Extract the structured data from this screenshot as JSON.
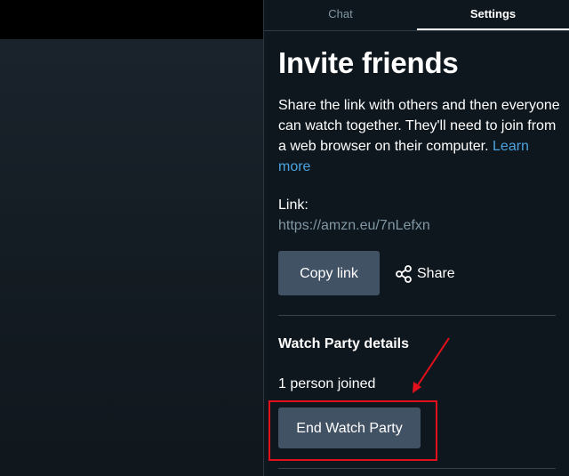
{
  "tabs": [
    {
      "label": "Chat",
      "active": false
    },
    {
      "label": "Settings",
      "active": true
    }
  ],
  "invite": {
    "title": "Invite friends",
    "description": "Share the link with others and then everyone can watch together. They'll need to join from a web browser on their computer.",
    "learn_more": "Learn more",
    "link_label": "Link:",
    "link_value": "https://amzn.eu/7nLefxn",
    "copy_button": "Copy link",
    "share_label": "Share",
    "share_icon": "share-icon"
  },
  "details": {
    "heading": "Watch Party details",
    "joined_text": "1 person joined",
    "end_button": "End Watch Party"
  },
  "colors": {
    "panel_bg": "#0f171e",
    "button_bg": "#425265",
    "link_color": "#4aa3df",
    "muted_text": "#8197a4",
    "annotation_red": "#e3101c"
  }
}
